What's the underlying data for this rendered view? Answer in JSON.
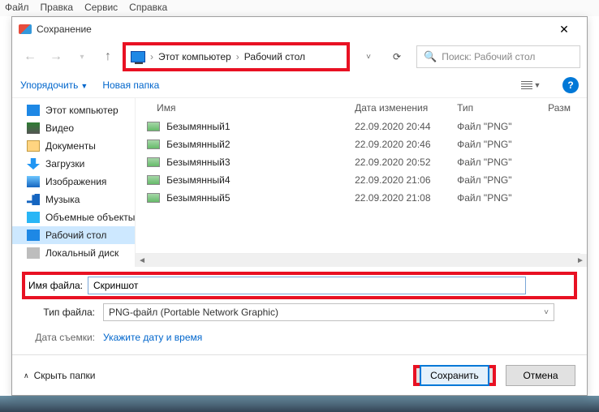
{
  "app_menu": {
    "items": [
      "Файл",
      "Правка",
      "Сервис",
      "Справка"
    ]
  },
  "dialog": {
    "title": "Сохранение",
    "breadcrumb": {
      "part1": "Этот компьютер",
      "part2": "Рабочий стол"
    },
    "search_placeholder": "Поиск: Рабочий стол",
    "toolbar": {
      "organize": "Упорядочить",
      "newfolder": "Новая папка"
    },
    "sidebar": [
      {
        "label": "Этот компьютер",
        "icon": "ic-pc"
      },
      {
        "label": "Видео",
        "icon": "ic-vid"
      },
      {
        "label": "Документы",
        "icon": "ic-doc"
      },
      {
        "label": "Загрузки",
        "icon": "ic-dl"
      },
      {
        "label": "Изображения",
        "icon": "ic-img"
      },
      {
        "label": "Музыка",
        "icon": "ic-mus"
      },
      {
        "label": "Объемные объекты",
        "icon": "ic-3d"
      },
      {
        "label": "Рабочий стол",
        "icon": "ic-desk",
        "selected": true
      },
      {
        "label": "Локальный диск",
        "icon": "ic-disk"
      }
    ],
    "columns": {
      "name": "Имя",
      "date": "Дата изменения",
      "type": "Тип",
      "size": "Разм"
    },
    "files": [
      {
        "name": "Безымянный1",
        "date": "22.09.2020 20:44",
        "type": "Файл \"PNG\""
      },
      {
        "name": "Безымянный2",
        "date": "22.09.2020 20:46",
        "type": "Файл \"PNG\""
      },
      {
        "name": "Безымянный3",
        "date": "22.09.2020 20:52",
        "type": "Файл \"PNG\""
      },
      {
        "name": "Безымянный4",
        "date": "22.09.2020 21:06",
        "type": "Файл \"PNG\""
      },
      {
        "name": "Безымянный5",
        "date": "22.09.2020 21:08",
        "type": "Файл \"PNG\""
      }
    ],
    "filename_label": "Имя файла:",
    "filename_value": "Скриншот",
    "filetype_label": "Тип файла:",
    "filetype_value": "PNG-файл (Portable Network Graphic)",
    "meta_label": "Дата съемки:",
    "meta_value": "Укажите дату и время",
    "hide_folders": "Скрыть папки",
    "save_button": "Сохранить",
    "cancel_button": "Отмена"
  }
}
